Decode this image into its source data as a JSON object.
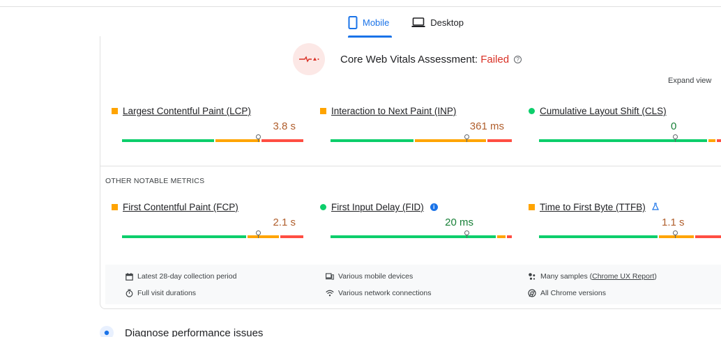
{
  "tabs": [
    {
      "label": "Mobile",
      "icon": "phone-icon",
      "active": true
    },
    {
      "label": "Desktop",
      "icon": "laptop-icon",
      "active": false
    }
  ],
  "assessment": {
    "prefix": "Core Web Vitals Assessment: ",
    "status": "Failed",
    "status_color": "#d93025"
  },
  "expand_view": "Expand view",
  "core_metrics": [
    {
      "name": "Largest Contentful Paint (LCP)",
      "value": "3.8 s",
      "rating": "needs-improvement",
      "value_color": "#b05e2c"
    },
    {
      "name": "Interaction to Next Paint (INP)",
      "value": "361 ms",
      "rating": "needs-improvement",
      "value_color": "#b05e2c"
    },
    {
      "name": "Cumulative Layout Shift (CLS)",
      "value": "0",
      "rating": "good",
      "value_color": "#188038"
    }
  ],
  "other_label": "OTHER NOTABLE METRICS",
  "other_metrics": [
    {
      "name": "First Contentful Paint (FCP)",
      "value": "2.1 s",
      "rating": "needs-improvement",
      "value_color": "#b05e2c"
    },
    {
      "name": "First Input Delay (FID)",
      "value": "20 ms",
      "rating": "good",
      "value_color": "#188038",
      "badge": "info-icon"
    },
    {
      "name": "Time to First Byte (TTFB)",
      "value": "1.1 s",
      "rating": "needs-improvement",
      "value_color": "#b05e2c",
      "badge": "flask-icon"
    }
  ],
  "footer": {
    "collection_period": "Latest 28-day collection period",
    "visit_durations": "Full visit durations",
    "devices": "Various mobile devices",
    "network": "Various network connections",
    "samples_prefix": "Many samples (",
    "samples_link": "Chrome UX Report",
    "samples_suffix": ")",
    "chrome_versions": "All Chrome versions"
  },
  "diagnose": "Diagnose performance issues",
  "colors": {
    "good": "#0cce6b",
    "needs_improvement": "#ffa400",
    "poor": "#ff4e42",
    "accent": "#1a73e8"
  }
}
